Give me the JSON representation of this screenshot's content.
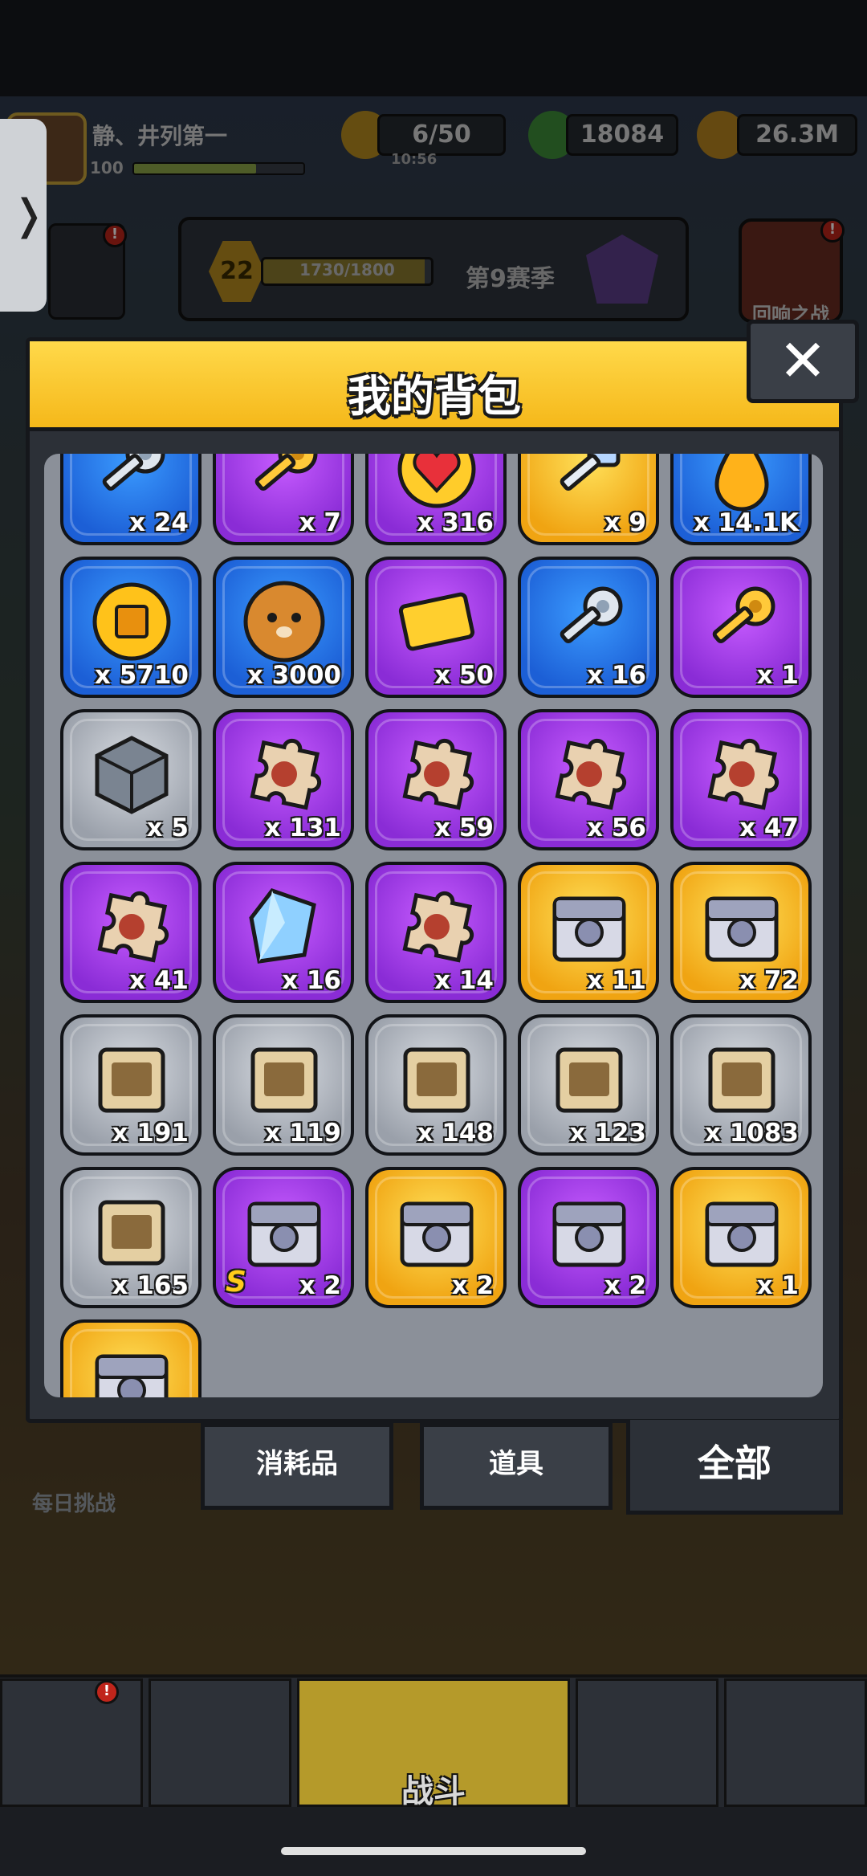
{
  "hud": {
    "player_name": "静、井列第一",
    "player_level": "100",
    "xp_fraction": 0.72,
    "energy": "6/50",
    "energy_timer": "10:56",
    "gems": "18084",
    "gold": "26.3M"
  },
  "season": {
    "level": "22",
    "progress_text": "1730/1800",
    "progress_fraction": 0.961,
    "name": "第9赛季"
  },
  "boss": {
    "label": "回响之战"
  },
  "daily": {
    "label": "每日挑战"
  },
  "modal": {
    "title": "我的背包",
    "close_label": "✕"
  },
  "items": [
    {
      "name": "silver-key",
      "rarity": "blue",
      "qty": "x 24",
      "icon": "silver-key-icon"
    },
    {
      "name": "gold-key",
      "rarity": "purple",
      "qty": "x 7",
      "icon": "gold-key-icon"
    },
    {
      "name": "heart-token",
      "rarity": "purple",
      "qty": "x 316",
      "icon": "heart-icon"
    },
    {
      "name": "crystal-key",
      "rarity": "gold",
      "qty": "x 9",
      "icon": "crystal-key-icon"
    },
    {
      "name": "gold-drop",
      "rarity": "blue",
      "qty": "x 14.1K",
      "icon": "drop-icon"
    },
    {
      "name": "gold-coin",
      "rarity": "blue",
      "qty": "x 5710",
      "icon": "coin-icon"
    },
    {
      "name": "dog-cookie",
      "rarity": "blue",
      "qty": "x 3000",
      "icon": "cookie-icon"
    },
    {
      "name": "gold-ticket",
      "rarity": "purple",
      "qty": "x 50",
      "icon": "ticket-icon"
    },
    {
      "name": "paw-silver-key",
      "rarity": "blue",
      "qty": "x 16",
      "icon": "silver-key-icon"
    },
    {
      "name": "paw-gold-key",
      "rarity": "purple",
      "qty": "x 1",
      "icon": "gold-key-icon"
    },
    {
      "name": "cube",
      "rarity": "gray",
      "qty": "x 5",
      "icon": "cube-icon"
    },
    {
      "name": "puzzle-red-1",
      "rarity": "purple",
      "qty": "x 131",
      "icon": "puzzle-icon"
    },
    {
      "name": "puzzle-red-2",
      "rarity": "purple",
      "qty": "x 59",
      "icon": "puzzle-icon"
    },
    {
      "name": "puzzle-green-1",
      "rarity": "purple",
      "qty": "x 56",
      "icon": "puzzle-icon"
    },
    {
      "name": "puzzle-tan",
      "rarity": "purple",
      "qty": "x 47",
      "icon": "puzzle-icon"
    },
    {
      "name": "puzzle-red-3",
      "rarity": "purple",
      "qty": "x 41",
      "icon": "puzzle-icon"
    },
    {
      "name": "blue-crystal",
      "rarity": "purple",
      "qty": "x 16",
      "icon": "crystal-icon"
    },
    {
      "name": "puzzle-green-2",
      "rarity": "purple",
      "qty": "x 14",
      "icon": "puzzle-icon"
    },
    {
      "name": "gold-chest-1",
      "rarity": "gold",
      "qty": "x 11",
      "icon": "chest-icon"
    },
    {
      "name": "gold-chest-2",
      "rarity": "gold",
      "qty": "x 72",
      "icon": "chest-icon"
    },
    {
      "name": "scroll-weapon",
      "rarity": "gray",
      "qty": "x 191",
      "icon": "scroll-icon"
    },
    {
      "name": "scroll-armor",
      "rarity": "gray",
      "qty": "x 119",
      "icon": "scroll-icon"
    },
    {
      "name": "scroll-necklace",
      "rarity": "gray",
      "qty": "x 148",
      "icon": "scroll-icon"
    },
    {
      "name": "scroll-belt",
      "rarity": "gray",
      "qty": "x 123",
      "icon": "scroll-icon"
    },
    {
      "name": "scroll-glove",
      "rarity": "gray",
      "qty": "x 1083",
      "icon": "scroll-icon"
    },
    {
      "name": "scroll-boots",
      "rarity": "gray",
      "qty": "x 165",
      "icon": "scroll-icon"
    },
    {
      "name": "s-chest",
      "rarity": "purple",
      "qty": "x 2",
      "icon": "chest-icon",
      "badge": "S"
    },
    {
      "name": "gold-chest-3",
      "rarity": "gold",
      "qty": "x 2",
      "icon": "chest-icon"
    },
    {
      "name": "purple-chest",
      "rarity": "purple",
      "qty": "x 2",
      "icon": "chest-icon"
    },
    {
      "name": "gold-chest-4",
      "rarity": "gold",
      "qty": "x 1",
      "icon": "chest-icon"
    },
    {
      "name": "gold-chest-5",
      "rarity": "gold",
      "qty": "",
      "icon": "chest-icon"
    }
  ],
  "tabs": [
    {
      "label": "消耗品",
      "active": false
    },
    {
      "label": "道具",
      "active": false
    },
    {
      "label": "全部",
      "active": true
    }
  ],
  "nav": {
    "battle_label": "战斗"
  },
  "colors": {
    "blue": "#1c5fd6",
    "purple": "#8a2cd6",
    "gold": "#f0a412",
    "gray": "#9aa0aa",
    "header": "#f5b81a"
  }
}
